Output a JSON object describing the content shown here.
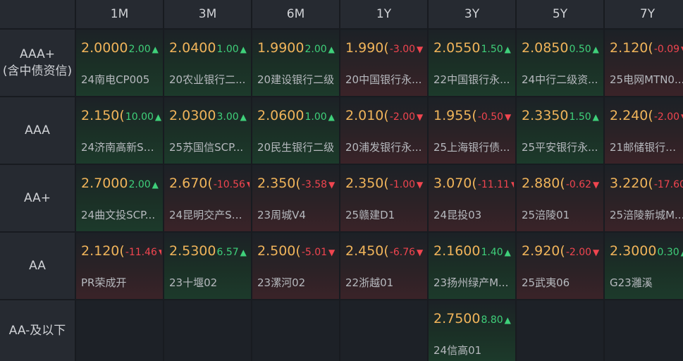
{
  "columns": [
    "1M",
    "3M",
    "6M",
    "1Y",
    "3Y",
    "5Y",
    "7Y"
  ],
  "rows": [
    {
      "label_lines": [
        "AAA+",
        "(含中债资信)"
      ],
      "cells": [
        {
          "price": "2.0000",
          "change": "2.00",
          "dir": "up",
          "bond": "24南电CP005"
        },
        {
          "price": "2.0400",
          "change": "1.00",
          "dir": "up",
          "bond": "20农业银行二..."
        },
        {
          "price": "1.9900",
          "change": "2.00",
          "dir": "up",
          "bond": "20建设银行二级"
        },
        {
          "price": "1.990(",
          "change": "-3.00",
          "dir": "down",
          "bond": "20中国银行永..."
        },
        {
          "price": "2.0550",
          "change": "1.50",
          "dir": "up",
          "bond": "22中国银行永..."
        },
        {
          "price": "2.0850",
          "change": "0.50",
          "dir": "up",
          "bond": "24中行二级资..."
        },
        {
          "price": "2.120(",
          "change": "-0.09",
          "dir": "down",
          "bond": "25电网MTN0..."
        }
      ]
    },
    {
      "label_lines": [
        "AAA"
      ],
      "cells": [
        {
          "price": "2.150(",
          "change": "10.00",
          "dir": "up",
          "bond": "24济南高新SC..."
        },
        {
          "price": "2.0300",
          "change": "3.00",
          "dir": "up",
          "bond": "25苏国信SCP..."
        },
        {
          "price": "2.0600",
          "change": "1.00",
          "dir": "up",
          "bond": "20民生银行二级"
        },
        {
          "price": "2.010(",
          "change": "-2.00",
          "dir": "down",
          "bond": "20浦发银行永..."
        },
        {
          "price": "1.955(",
          "change": "-0.50",
          "dir": "down",
          "bond": "25上海银行债..."
        },
        {
          "price": "2.3350",
          "change": "1.50",
          "dir": "up",
          "bond": "25平安银行永..."
        },
        {
          "price": "2.240(",
          "change": "-2.00",
          "dir": "down",
          "bond": "21邮储银行二..."
        }
      ]
    },
    {
      "label_lines": [
        "AA+"
      ],
      "cells": [
        {
          "price": "2.7000",
          "change": "2.00",
          "dir": "up",
          "bond": "24曲文投SCP..."
        },
        {
          "price": "2.670(",
          "change": "-10.56",
          "dir": "down",
          "bond": "24昆明交产SC..."
        },
        {
          "price": "2.350(",
          "change": "-3.58",
          "dir": "down",
          "bond": "23周城V4"
        },
        {
          "price": "2.350(",
          "change": "-1.00",
          "dir": "down",
          "bond": "25赣建D1"
        },
        {
          "price": "3.070(",
          "change": "-11.11",
          "dir": "down",
          "bond": "24昆投03"
        },
        {
          "price": "2.880(",
          "change": "-0.62",
          "dir": "down",
          "bond": "25涪陵01"
        },
        {
          "price": "3.220(",
          "change": "-17.60",
          "dir": "down",
          "bond": "25涪陵新城M..."
        }
      ]
    },
    {
      "label_lines": [
        "AA"
      ],
      "cells": [
        {
          "price": "2.120(",
          "change": "-11.46",
          "dir": "down",
          "bond": "PR荣成开"
        },
        {
          "price": "2.5300",
          "change": "6.57",
          "dir": "up",
          "bond": "23十堰02"
        },
        {
          "price": "2.500(",
          "change": "-5.01",
          "dir": "down",
          "bond": "23漯河02"
        },
        {
          "price": "2.450(",
          "change": "-6.76",
          "dir": "down",
          "bond": "22浙越01"
        },
        {
          "price": "2.1600",
          "change": "1.40",
          "dir": "up",
          "bond": "23扬州绿产M..."
        },
        {
          "price": "2.920(",
          "change": "-2.00",
          "dir": "down",
          "bond": "25武夷06"
        },
        {
          "price": "2.3000",
          "change": "0.30",
          "dir": "up",
          "bond": "G23灉溪"
        }
      ]
    },
    {
      "label_lines": [
        "AA-及以下"
      ],
      "cells": [
        null,
        null,
        null,
        null,
        {
          "price": "2.7500",
          "change": "8.80",
          "dir": "up",
          "bond": "24信高01"
        },
        null,
        null
      ]
    }
  ],
  "colors": {
    "price": "#f0b45a",
    "up": "#3fd07a",
    "down": "#f0454f",
    "header_bg": "#262a31",
    "page_bg": "#181b20"
  },
  "icons": {
    "up": "triangle-up-icon",
    "down": "triangle-down-icon"
  }
}
